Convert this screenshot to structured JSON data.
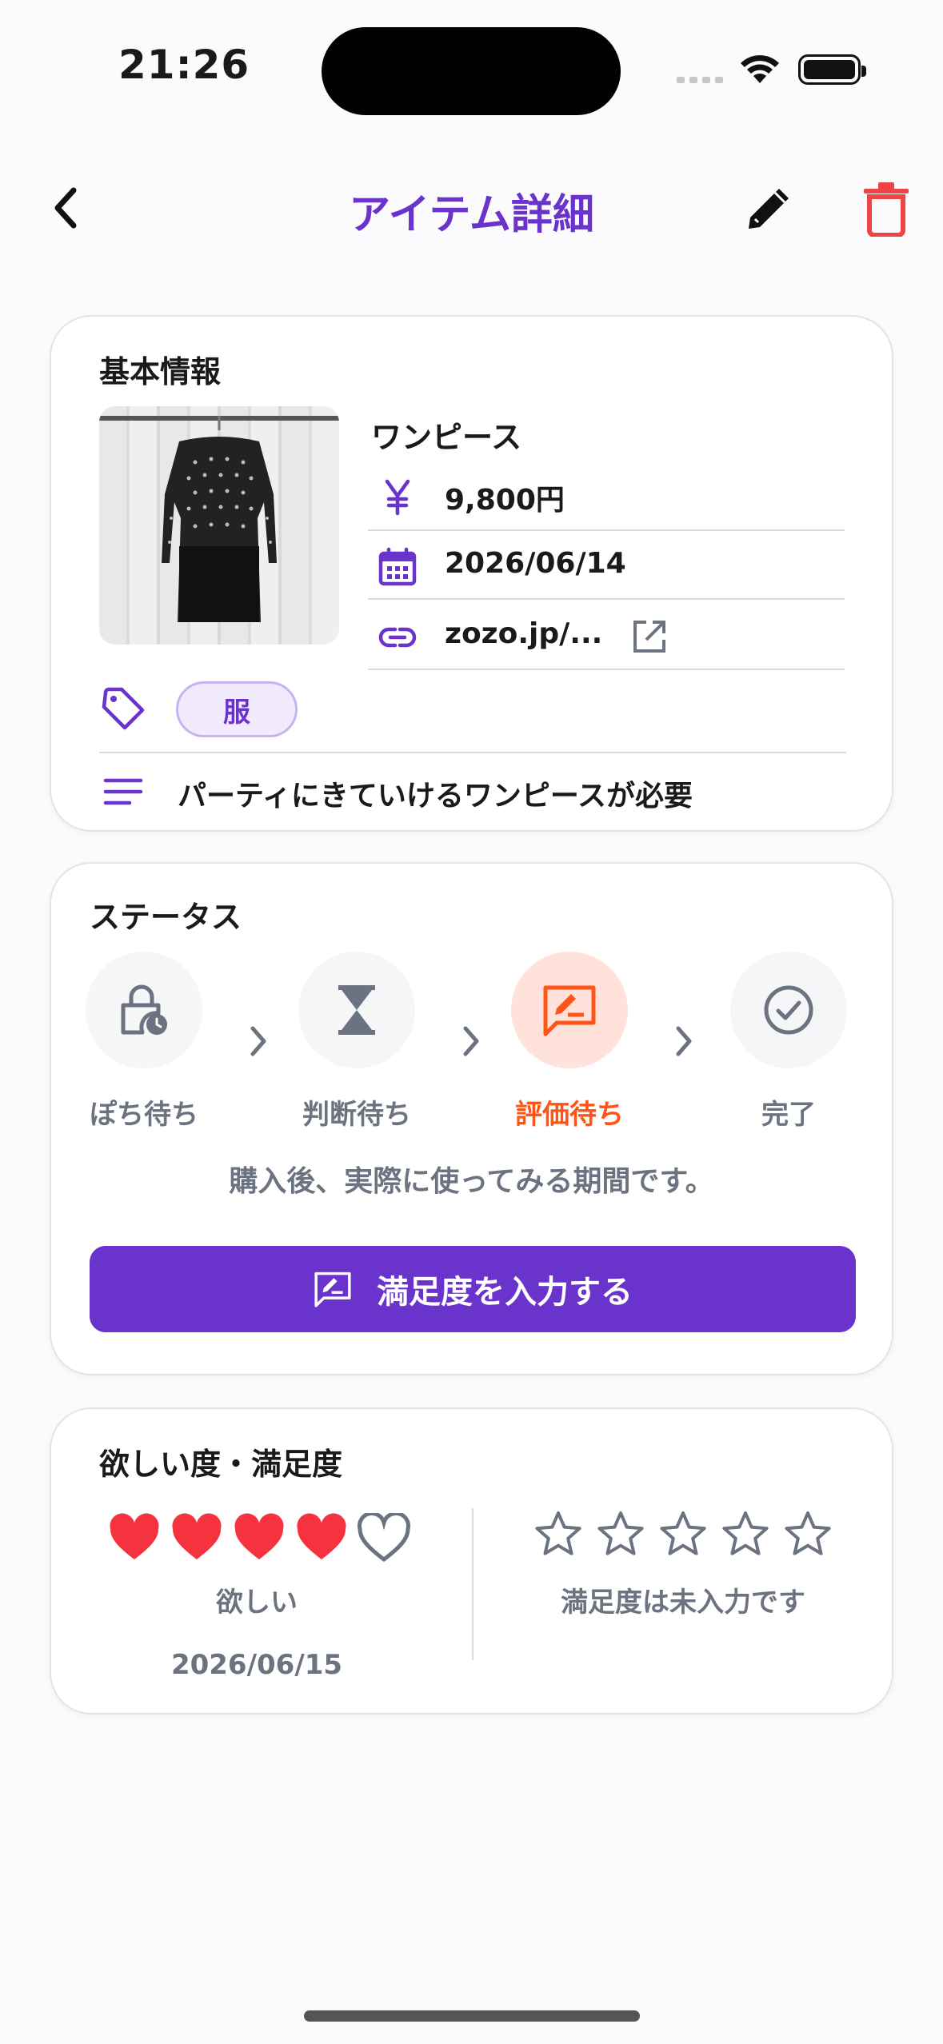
{
  "status_bar": {
    "time": "21:26"
  },
  "header": {
    "title": "アイテム詳細"
  },
  "basic_info": {
    "section_title": "基本情報",
    "item_name": "ワンピース",
    "price": "9,800円",
    "date": "2026/06/14",
    "url": "zozo.jp/...",
    "tag": "服",
    "note": "パーティにきていけるワンピースが必要"
  },
  "status": {
    "section_title": "ステータス",
    "steps": [
      {
        "label": "ぽち待ち",
        "icon": "lock-clock-icon"
      },
      {
        "label": "判断待ち",
        "icon": "hourglass-icon"
      },
      {
        "label": "評価待ち",
        "icon": "rate-review-icon",
        "active": true
      },
      {
        "label": "完了",
        "icon": "check-circle-icon"
      }
    ],
    "description": "購入後、実際に使ってみる期間です。",
    "action_label": "満足度を入力する"
  },
  "ratings": {
    "section_title": "欲しい度・満足度",
    "want_level": 4,
    "want_max": 5,
    "want_label": "欲しい",
    "want_date": "2026/06/15",
    "satisfaction_level": 0,
    "satisfaction_max": 5,
    "satisfaction_label": "満足度は未入力です"
  },
  "colors": {
    "accent": "#6a34cc",
    "danger": "#ef4444",
    "active_step": "#ff5416",
    "heart": "#f5333f"
  }
}
